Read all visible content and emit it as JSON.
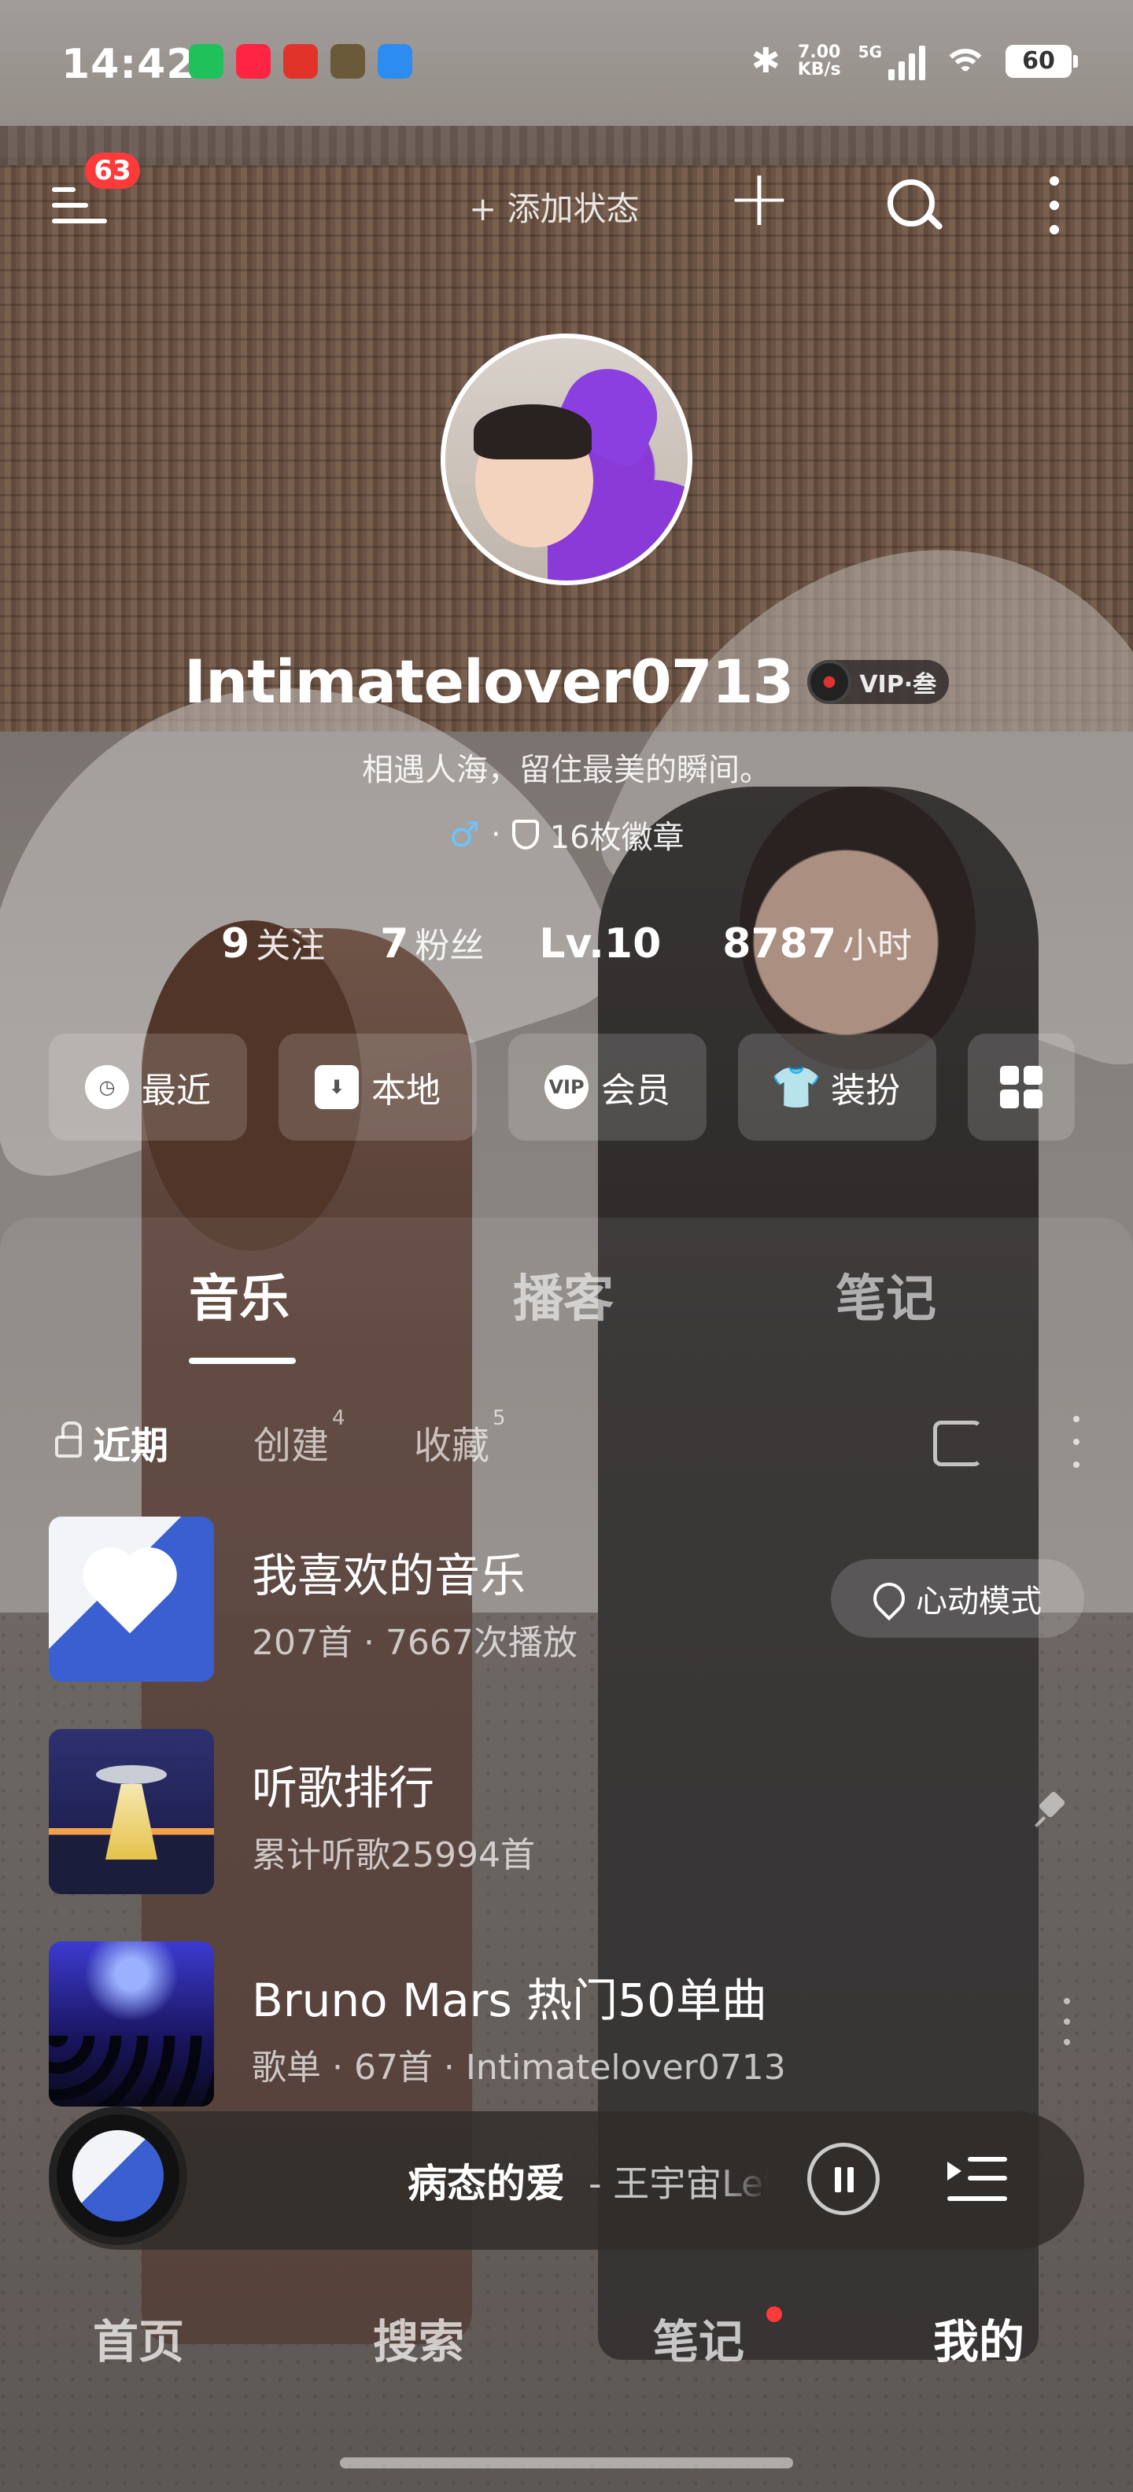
{
  "status_bar": {
    "time": "14:42",
    "net_speed_value": "7.00",
    "net_speed_unit": "KB/s",
    "network": "5G",
    "battery": "60",
    "app_icons": [
      "wechat-icon",
      "xiaohongshu-icon",
      "app-icon-red",
      "app-icon-game",
      "browser-icon"
    ]
  },
  "top_bar": {
    "notification_count": "63",
    "add_status_label": "+ 添加状态"
  },
  "profile": {
    "username": "Intimatelover0713",
    "vip_label": "VIP·叁",
    "signature": "相遇人海，留住最美的瞬间。",
    "gender_symbol": "♂",
    "separator": "·",
    "badges_label": "16枚徽章"
  },
  "stats": [
    {
      "value": "9",
      "label": "关注"
    },
    {
      "value": "7",
      "label": "粉丝"
    },
    {
      "value": "Lv.10",
      "label": ""
    },
    {
      "value": "8787",
      "label": "小时"
    }
  ],
  "quick_actions": [
    {
      "label": "最近",
      "icon": "clock-icon"
    },
    {
      "label": "本地",
      "icon": "download-icon"
    },
    {
      "label": "会员",
      "icon": "vip-icon"
    },
    {
      "label": "装扮",
      "icon": "shirt-icon"
    }
  ],
  "content_tabs": [
    "音乐",
    "播客",
    "笔记"
  ],
  "sub_tabs": {
    "recent": "近期",
    "created": "创建",
    "created_count": "4",
    "collected": "收藏",
    "collected_count": "5"
  },
  "playlists": [
    {
      "title": "我喜欢的音乐",
      "subtitle": "207首 · 7667次播放",
      "action_label": "心动模式"
    },
    {
      "title": "听歌排行",
      "subtitle": "累计听歌25994首"
    },
    {
      "title": "Bruno Mars 热门50单曲",
      "subtitle": "歌单 · 67首 · Intimatelover0713"
    }
  ],
  "player": {
    "title": "病态的爱",
    "artist": " - 王宇宙Leto"
  },
  "bottom_nav": [
    "首页",
    "搜索",
    "笔记",
    "我的"
  ],
  "colors": {
    "badge_red": "#ff3a3a",
    "gender_blue": "#6ec3ff"
  }
}
